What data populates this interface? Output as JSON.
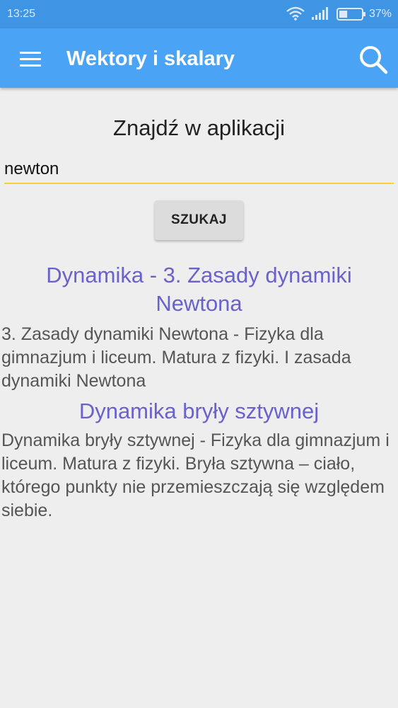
{
  "status_bar": {
    "time": "13:25",
    "battery_percent": "37%",
    "battery_level": 0.37,
    "icons": [
      "wifi-icon",
      "signal-icon",
      "battery-icon"
    ]
  },
  "app_bar": {
    "title": "Wektory i skalary",
    "menu_icon": "hamburger-menu-icon",
    "search_icon": "search-icon",
    "color": "#4aa3f5"
  },
  "search": {
    "heading": "Znajdź w aplikacji",
    "value": "newton",
    "button_label": "SZUKAJ",
    "underline_color": "#f3d23a"
  },
  "results": [
    {
      "title": "Dynamika - 3. Zasady dynamiki Newtona",
      "description": "3. Zasady dynamiki Newtona - Fizyka dla gimnazjum i liceum. Matura z fizyki. I zasada dynamiki Newtona"
    },
    {
      "title": "Dynamika bryły sztywnej",
      "description": "Dynamika bryły sztywnej - Fizyka dla gimnazjum i liceum. Matura z fizyki. Bryła sztywna – ciało, którego punkty nie przemieszczają się względem siebie."
    }
  ],
  "colors": {
    "link": "#6a62cc",
    "status_bar": "#3f95e4"
  }
}
